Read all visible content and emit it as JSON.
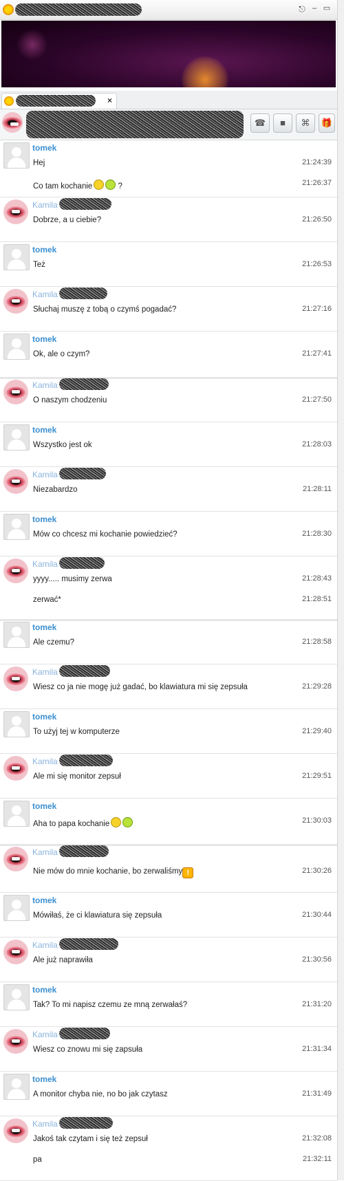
{
  "window": {
    "minimize_label": "–",
    "restore_label": "▭"
  },
  "toolbar": {
    "phone_icon": "☎",
    "video_icon": "■",
    "game_icon": "⌘",
    "gift_icon": "🎁"
  },
  "tab": {
    "close_label": "×"
  },
  "messages": [
    {
      "sender": "tomek",
      "lines": [
        {
          "text": "Hej",
          "time": "21:24:39"
        },
        {
          "text": "Co tam kochanie",
          "time": "21:26:37",
          "emoji": [
            "smile",
            "smile-green"
          ],
          "suffix": " ?"
        }
      ]
    },
    {
      "sender": "Kamila",
      "lines": [
        {
          "text": "Dobrze, a u ciebie?",
          "time": "21:26:50"
        }
      ]
    },
    {
      "sender": "tomek",
      "lines": [
        {
          "text": "Też",
          "time": "21:26:53"
        }
      ]
    },
    {
      "sender": "Kamila",
      "lines": [
        {
          "text": "Słuchaj muszę z tobą o czymś pogadać?",
          "time": "21:27:16"
        }
      ]
    },
    {
      "sender": "tomek",
      "lines": [
        {
          "text": "Ok, ale o czym?",
          "time": "21:27:41"
        }
      ]
    },
    {
      "sender": "Kamila",
      "lines": [
        {
          "text": "O naszym chodzeniu",
          "time": "21:27:50"
        }
      ]
    },
    {
      "sender": "tomek",
      "lines": [
        {
          "text": "Wszystko jest ok",
          "time": "21:28:03"
        }
      ]
    },
    {
      "sender": "Kamila",
      "lines": [
        {
          "text": "Niezabardzo",
          "time": "21:28:11"
        }
      ]
    },
    {
      "sender": "tomek",
      "lines": [
        {
          "text": "Mów co chcesz mi kochanie powiedzieć?",
          "time": "21:28:30"
        }
      ]
    },
    {
      "sender": "Kamila",
      "lines": [
        {
          "text": "yyyy..... musimy zerwa",
          "time": "21:28:43"
        },
        {
          "text": "zerwać*",
          "time": "21:28:51"
        }
      ]
    },
    {
      "sender": "tomek",
      "lines": [
        {
          "text": "Ale czemu?",
          "time": "21:28:58"
        }
      ]
    },
    {
      "sender": "Kamila",
      "lines": [
        {
          "text": "Wiesz co ja nie mogę już gadać, bo klawiatura mi się zepsuła",
          "time": "21:29:28"
        }
      ]
    },
    {
      "sender": "tomek",
      "lines": [
        {
          "text": "To użyj tej w komputerze",
          "time": "21:29:40"
        }
      ]
    },
    {
      "sender": "Kamila",
      "lines": [
        {
          "text": "Ale mi się monitor zepsuł",
          "time": "21:29:51"
        }
      ]
    },
    {
      "sender": "tomek",
      "lines": [
        {
          "text": "Aha to papa kochanie",
          "time": "21:30:03",
          "emoji": [
            "smile",
            "smile-green"
          ]
        }
      ]
    },
    {
      "sender": "Kamila",
      "lines": [
        {
          "text": "Nie mów do mnie kochanie, bo zerwaliśmy",
          "time": "21:30:26",
          "emoji": [
            "warning"
          ]
        }
      ]
    },
    {
      "sender": "tomek",
      "lines": [
        {
          "text": "Mówiłaś, że ci klawiatura się zepsuła",
          "time": "21:30:44"
        }
      ]
    },
    {
      "sender": "Kamila",
      "lines": [
        {
          "text": "Ale już naprawiła",
          "time": "21:30:56"
        }
      ]
    },
    {
      "sender": "tomek",
      "lines": [
        {
          "text": "Tak? To mi napisz czemu ze mną zerwałaś?",
          "time": "21:31:20"
        }
      ]
    },
    {
      "sender": "Kamila",
      "lines": [
        {
          "text": "Wiesz co znowu mi się zapsuła",
          "time": "21:31:34"
        }
      ]
    },
    {
      "sender": "tomek",
      "lines": [
        {
          "text": "A monitor chyba nie, no bo jak czytasz",
          "time": "21:31:49"
        }
      ]
    },
    {
      "sender": "Kamila",
      "lines": [
        {
          "text": "Jakoś tak czytam i się też zepsuł",
          "time": "21:32:08"
        },
        {
          "text": "pa",
          "time": "21:32:11"
        }
      ]
    }
  ]
}
